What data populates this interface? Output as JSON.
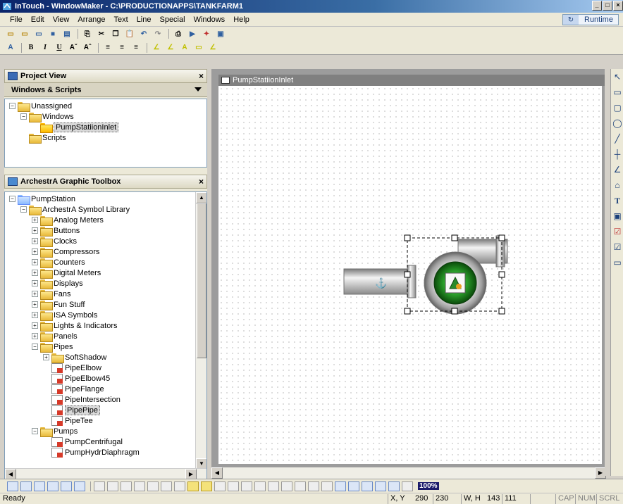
{
  "window": {
    "title": "InTouch - WindowMaker - C:\\PRODUCTIONAPPS\\TANKFARM1"
  },
  "menu": [
    "File",
    "Edit",
    "View",
    "Arrange",
    "Text",
    "Line",
    "Special",
    "Windows",
    "Help"
  ],
  "runtime_label": "Runtime",
  "project_view": {
    "title": "Project View",
    "section": "Windows & Scripts",
    "tree": [
      {
        "label": "Unassigned",
        "level": 0,
        "icon": "folder-icon",
        "pm": "−"
      },
      {
        "label": "Windows",
        "level": 1,
        "icon": "folder-icon",
        "pm": "−"
      },
      {
        "label": "PumpStatiionInlet",
        "level": 2,
        "icon": "window-icon",
        "pm": "",
        "selected": true
      },
      {
        "label": "Scripts",
        "level": 1,
        "icon": "scripts-icon",
        "pm": ""
      }
    ]
  },
  "toolbox": {
    "title": "ArchestrA Graphic Toolbox",
    "tree": [
      {
        "label": "PumpStation",
        "level": 0,
        "icon": "galaxy-icon",
        "pm": "−"
      },
      {
        "label": "ArchestrA Symbol Library",
        "level": 1,
        "icon": "folder-icon",
        "pm": "−"
      },
      {
        "label": "Analog Meters",
        "level": 2,
        "icon": "folder-icon",
        "pm": "+"
      },
      {
        "label": "Buttons",
        "level": 2,
        "icon": "folder-icon",
        "pm": "+"
      },
      {
        "label": "Clocks",
        "level": 2,
        "icon": "folder-icon",
        "pm": "+"
      },
      {
        "label": "Compressors",
        "level": 2,
        "icon": "folder-icon",
        "pm": "+"
      },
      {
        "label": "Counters",
        "level": 2,
        "icon": "folder-icon",
        "pm": "+"
      },
      {
        "label": "Digital Meters",
        "level": 2,
        "icon": "folder-icon",
        "pm": "+"
      },
      {
        "label": "Displays",
        "level": 2,
        "icon": "folder-icon",
        "pm": "+"
      },
      {
        "label": "Fans",
        "level": 2,
        "icon": "folder-icon",
        "pm": "+"
      },
      {
        "label": "Fun Stuff",
        "level": 2,
        "icon": "folder-icon",
        "pm": "+"
      },
      {
        "label": "ISA Symbols",
        "level": 2,
        "icon": "folder-icon",
        "pm": "+"
      },
      {
        "label": "Lights & Indicators",
        "level": 2,
        "icon": "folder-icon",
        "pm": "+"
      },
      {
        "label": "Panels",
        "level": 2,
        "icon": "folder-icon",
        "pm": "+"
      },
      {
        "label": "Pipes",
        "level": 2,
        "icon": "folder-icon",
        "pm": "−"
      },
      {
        "label": "SoftShadow",
        "level": 3,
        "icon": "folder-icon",
        "pm": "+"
      },
      {
        "label": "PipeElbow",
        "level": 3,
        "icon": "symbol-icon",
        "pm": ""
      },
      {
        "label": "PipeElbow45",
        "level": 3,
        "icon": "symbol-icon",
        "pm": ""
      },
      {
        "label": "PipeFlange",
        "level": 3,
        "icon": "symbol-icon",
        "pm": ""
      },
      {
        "label": "PipeIntersection",
        "level": 3,
        "icon": "symbol-icon",
        "pm": ""
      },
      {
        "label": "PipePipe",
        "level": 3,
        "icon": "symbol-icon",
        "pm": "",
        "selected": true
      },
      {
        "label": "PipeTee",
        "level": 3,
        "icon": "symbol-icon",
        "pm": ""
      },
      {
        "label": "Pumps",
        "level": 2,
        "icon": "folder-icon",
        "pm": "−"
      },
      {
        "label": "PumpCentrifugal",
        "level": 3,
        "icon": "symbol-icon",
        "pm": ""
      },
      {
        "label": "PumpHydrDiaphragm",
        "level": 3,
        "icon": "symbol-icon",
        "pm": ""
      }
    ]
  },
  "document": {
    "title": "PumpStatiionInlet"
  },
  "zoom": "100%",
  "status": {
    "ready": "Ready",
    "xy_label": "X, Y",
    "x": "290",
    "y": "230",
    "wh_label": "W, H",
    "w": "143",
    "h": "111",
    "cap": "CAP",
    "num": "NUM",
    "scrl": "SCRL"
  },
  "colors": {
    "title_bar": "#0a246a",
    "pump_green": "#1e8a1e",
    "pipe_gray": "#b8b8b8"
  }
}
